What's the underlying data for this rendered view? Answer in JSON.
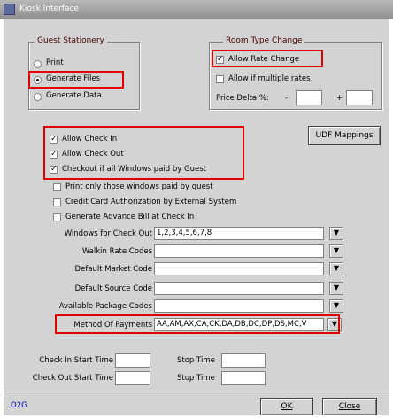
{
  "window": {
    "title": "Kiosk Interface"
  },
  "guest_stationery": {
    "legend": "Guest Stationery",
    "options": [
      {
        "label": "Print",
        "selected": false
      },
      {
        "label": "Generate Files",
        "selected": true
      },
      {
        "label": "Generate Data",
        "selected": false
      }
    ]
  },
  "room_type_change": {
    "legend": "Room Type Change",
    "allow_rate_change": {
      "label": "Allow Rate Change",
      "checked": true
    },
    "allow_multiple_rates": {
      "label": "Allow if multiple rates",
      "checked": false
    },
    "price_delta_label": "Price Delta %:",
    "minus": "-",
    "plus": "+",
    "min_value": "",
    "max_value": ""
  },
  "checkout_options": [
    {
      "label": "Allow Check In",
      "checked": true
    },
    {
      "label": "Allow Check Out",
      "checked": true
    },
    {
      "label": "Checkout if all Windows paid by Guest",
      "checked": true
    },
    {
      "label": "Print only those windows paid by guest",
      "checked": false
    },
    {
      "label": "Credit Card Authorization by External System",
      "checked": false
    },
    {
      "label": "Generate Advance Bill at Check In",
      "checked": false
    }
  ],
  "udf_button": "UDF Mappings",
  "fields": [
    {
      "label": "Windows for Check Out",
      "value": "1,2,3,4,5,6,7,8"
    },
    {
      "label": "Walkin Rate Codes",
      "value": ""
    },
    {
      "label": "Default Market Code",
      "value": ""
    },
    {
      "label": "Default Source Code",
      "value": ""
    },
    {
      "label": "Available Package Codes",
      "value": ""
    },
    {
      "label": "Method Of Payments",
      "value": "AA,AM,AX,CA,CK,DA,DB,DC,DP,DS,MC,V"
    }
  ],
  "dropdown_glyph": "▼",
  "times": {
    "check_in_start": "Check In Start Time",
    "check_out_start": "Check Out Start Time",
    "stop": "Stop Time",
    "check_in_start_value": "",
    "check_in_stop_value": "",
    "check_out_start_value": "",
    "check_out_stop_value": ""
  },
  "footer": {
    "code": "O2G",
    "ok": "OK",
    "close": "Close"
  },
  "colors": {
    "highlight": "#e00000",
    "panel": "#d3d3d3",
    "footer_code": "#0000c0"
  }
}
